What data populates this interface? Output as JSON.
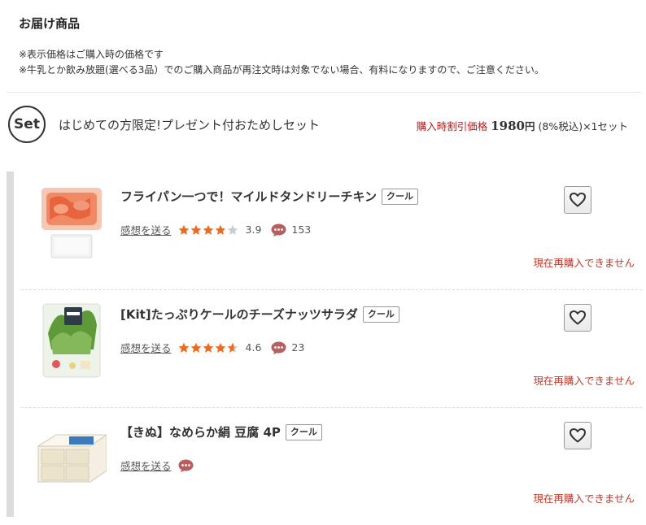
{
  "section": {
    "title": "お届け商品",
    "notes": [
      "※表示価格はご購入時の価格です",
      "※牛乳とか飲み放題(選べる3品）でのご購入商品が再注文時は対象でない場合、有料になりますので、ご注意ください。"
    ]
  },
  "set": {
    "badge": "Set",
    "name": "はじめての方限定!プレゼント付おためしセット",
    "price_label": "購入時割引価格",
    "price_value": "1980",
    "price_yen": "円",
    "price_tax": "(8%税込)×1セット"
  },
  "items": [
    {
      "name": "フライパン一つで！マイルドタンドリーチキン",
      "tag": "クール",
      "review_link": "感想を送る",
      "rating": 3.9,
      "rating_text": "3.9",
      "review_count": "153",
      "status": "現在再購入できません",
      "image_icon": "tandoori-chicken-package-image"
    },
    {
      "name": "[Kit]たっぷりケールのチーズナッツサラダ",
      "tag": "クール",
      "review_link": "感想を送る",
      "rating": 4.6,
      "rating_text": "4.6",
      "review_count": "23",
      "status": "現在再購入できません",
      "image_icon": "kale-salad-kit-image"
    },
    {
      "name": "【きぬ】なめらか絹 豆腐 4P",
      "tag": "クール",
      "review_link": "感想を送る",
      "rating": null,
      "rating_text": "",
      "review_count": "",
      "status": "現在再購入できません",
      "image_icon": "tofu-package-image"
    }
  ],
  "colors": {
    "star": "#ee6a1f",
    "star_empty": "#cccccc",
    "accent_red": "#c0392b",
    "comment_icon": "#b56060"
  }
}
